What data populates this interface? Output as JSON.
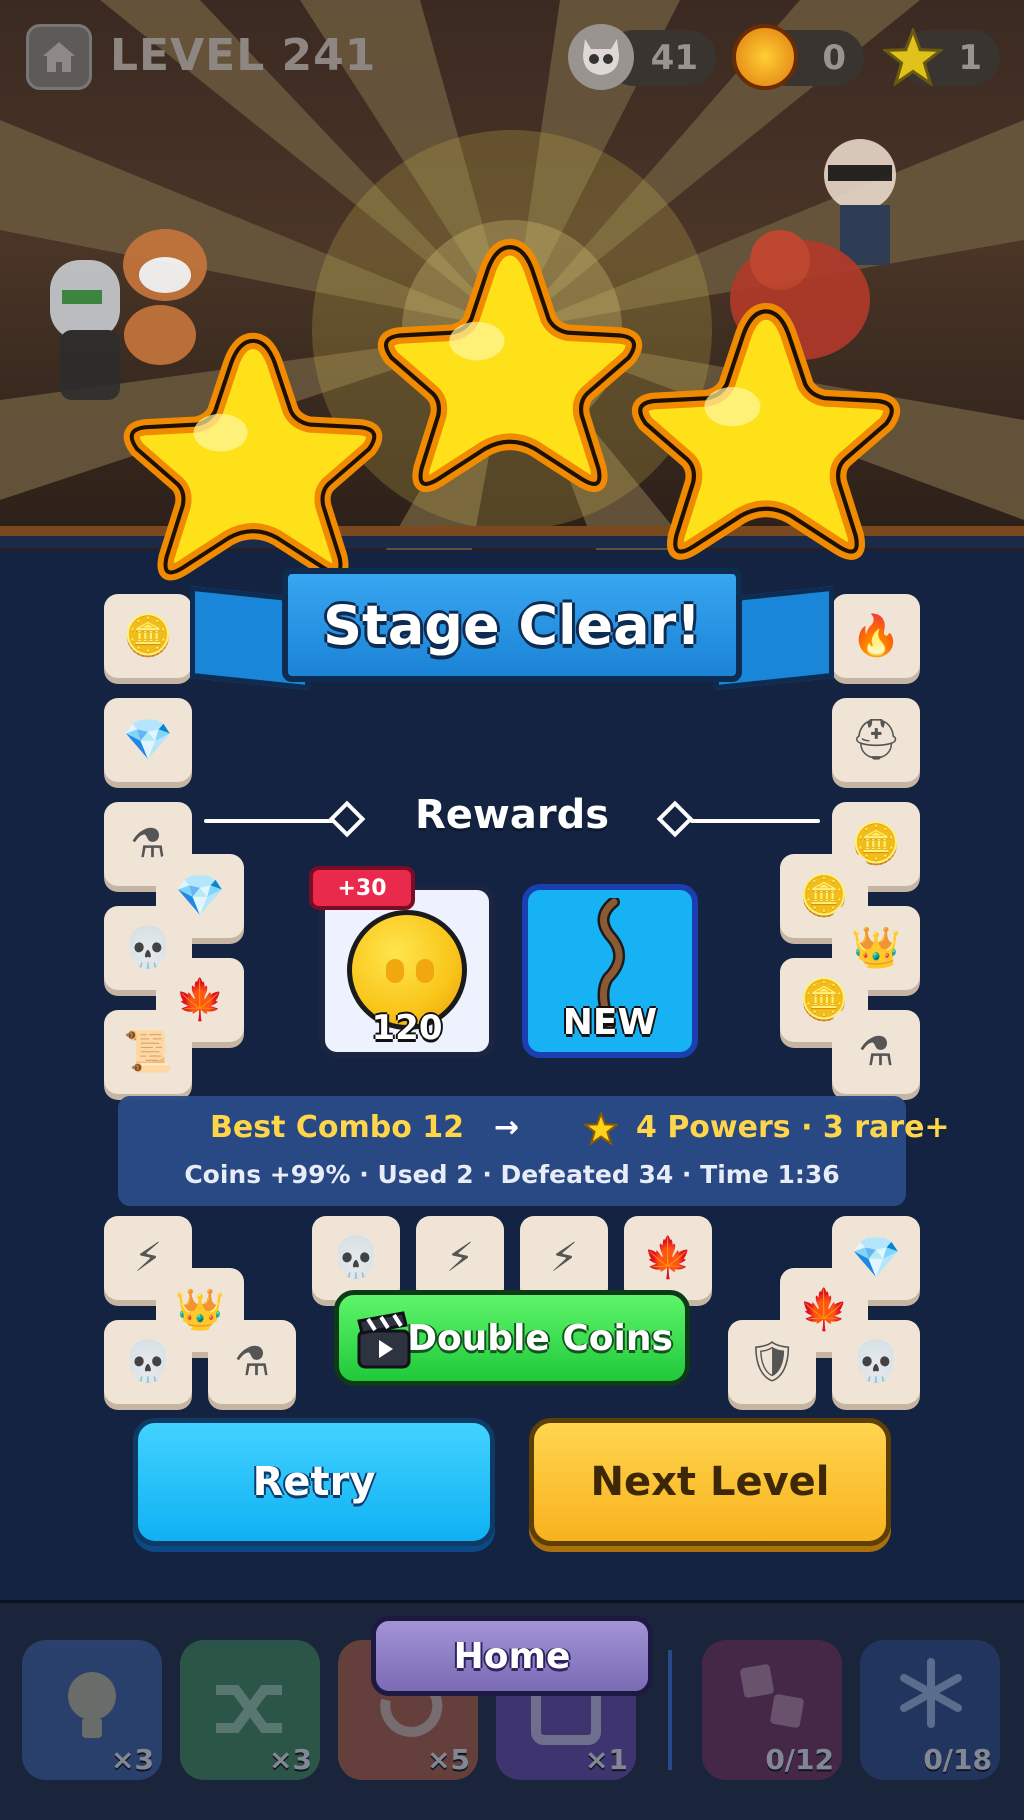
{
  "hud": {
    "level_label": "LEVEL 241",
    "skulls": "41",
    "coins": "0",
    "stars": "1"
  },
  "result": {
    "stars_earned": 3,
    "title": "Stage Clear!"
  },
  "rewards": {
    "title": "Rewards",
    "coin_bonus_badge": "+30",
    "coin_amount": "120",
    "new_item_label": "NEW"
  },
  "stats": {
    "best_combo": "Best Combo 12",
    "arrow": "→",
    "powers": "4 Powers · 3 rare+",
    "detail": "Coins +99%  ·  Used 2  ·  Defeated 34  ·  Time 1:36"
  },
  "buttons": {
    "double_coins": "Double Coins",
    "retry": "Retry",
    "next_level": "Next Level",
    "home": "Home"
  },
  "powers": [
    {
      "name": "hint",
      "count": "×3",
      "color": "#3f62a8"
    },
    {
      "name": "shuffle",
      "count": "×3",
      "color": "#3f8f55"
    },
    {
      "name": "undo",
      "count": "×5",
      "color": "#c0603a"
    },
    {
      "name": "frame",
      "count": "×1",
      "color": "#6a4ab0"
    },
    {
      "name": "merge",
      "count": "0/12",
      "color": "#7a2a55"
    },
    {
      "name": "freeze",
      "count": "0/18",
      "color": "#2a4a88"
    }
  ],
  "colors": {
    "banner_blue": "#1b83d6",
    "star_yellow": "#ffe000",
    "star_outline": "#f08a00",
    "button_green": "#20c93a",
    "button_blue": "#0fb1f3",
    "button_yellow": "#f8b21d",
    "button_purple": "#7a6bb5"
  }
}
